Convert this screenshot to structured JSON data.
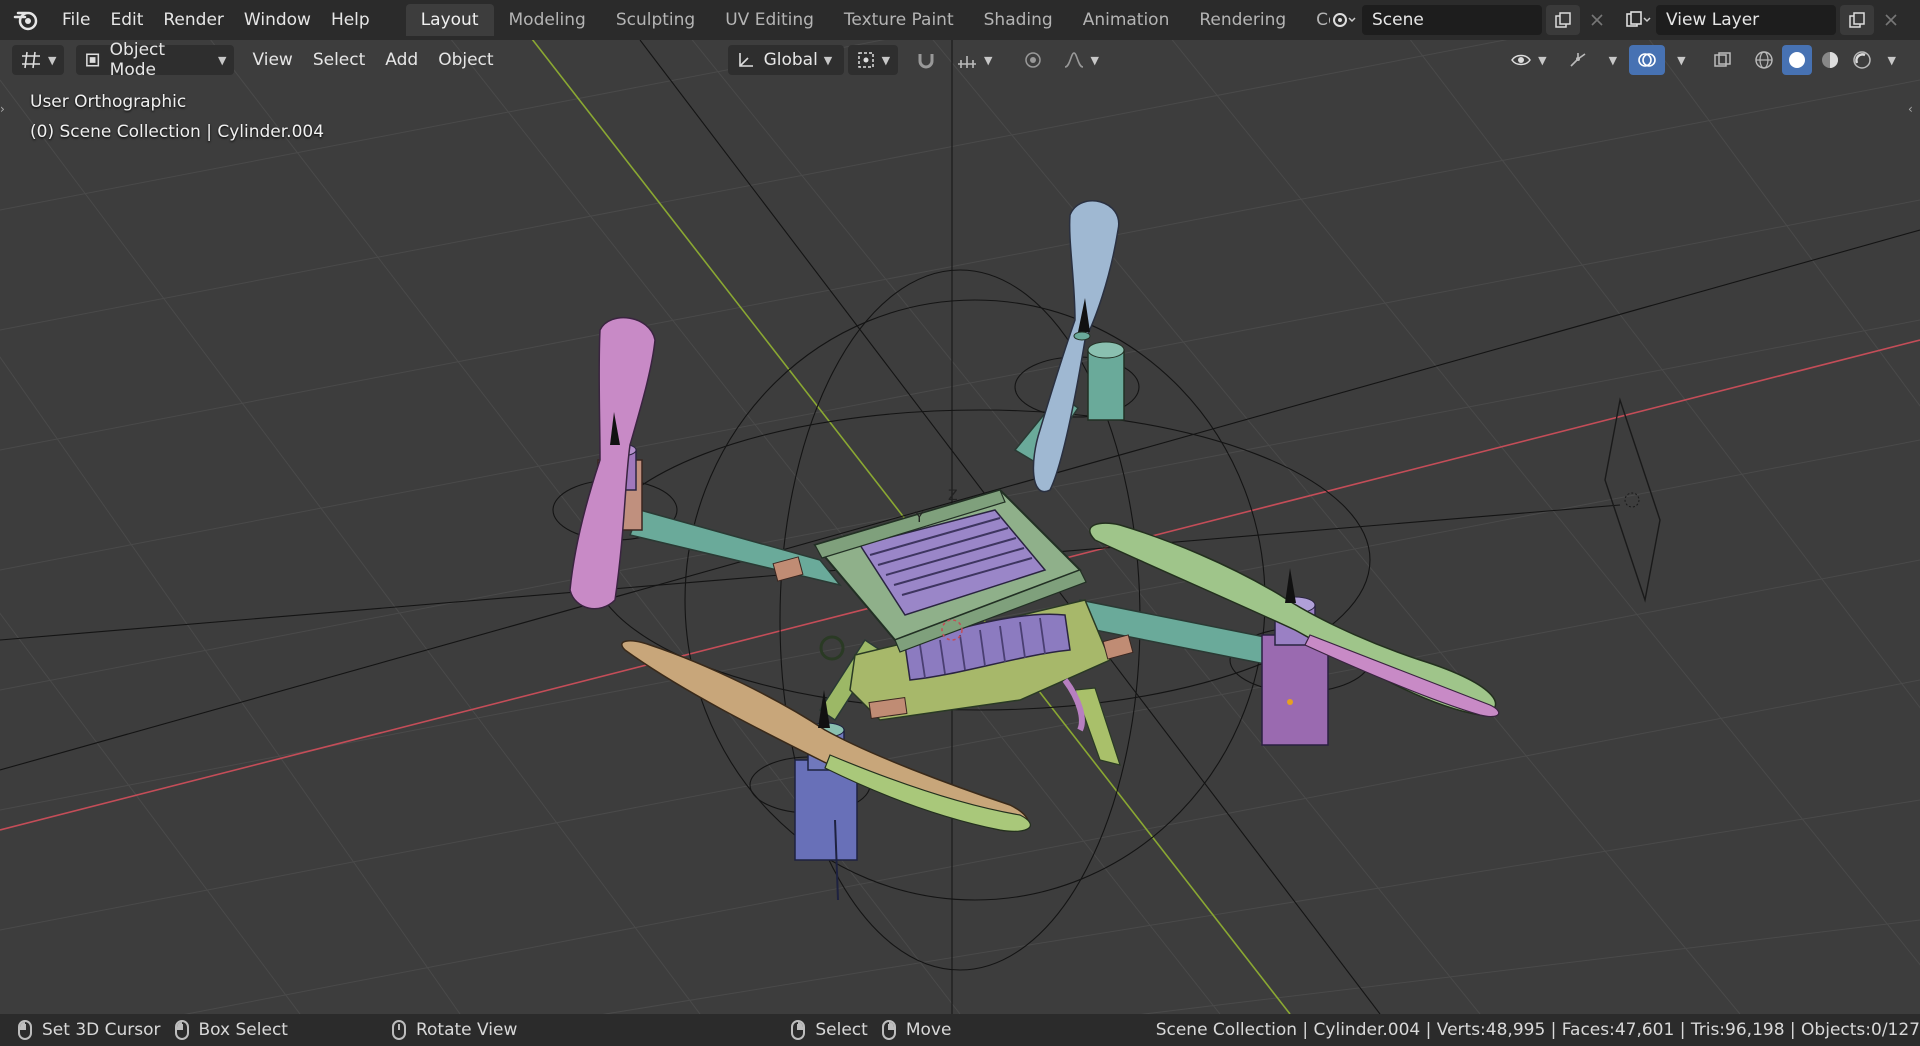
{
  "menu": [
    "File",
    "Edit",
    "Render",
    "Window",
    "Help"
  ],
  "workspace_tabs": [
    {
      "label": "Layout",
      "active": true
    },
    {
      "label": "Modeling",
      "active": false
    },
    {
      "label": "Sculpting",
      "active": false
    },
    {
      "label": "UV Editing",
      "active": false
    },
    {
      "label": "Texture Paint",
      "active": false
    },
    {
      "label": "Shading",
      "active": false
    },
    {
      "label": "Animation",
      "active": false
    },
    {
      "label": "Rendering",
      "active": false
    },
    {
      "label": "Compos",
      "active": false
    }
  ],
  "scene": {
    "name": "Scene",
    "view_layer": "View Layer"
  },
  "header": {
    "mode": "Object Mode",
    "view": "View",
    "select": "Select",
    "add": "Add",
    "object": "Object",
    "orientation": "Global"
  },
  "viewport": {
    "view_name": "User Orthographic",
    "collection_info": "(0) Scene Collection | Cylinder.004",
    "background": "#3d3d3d"
  },
  "statusbar": {
    "set_cursor": "Set 3D Cursor",
    "box_select": "Box Select",
    "rotate_view": "Rotate View",
    "select": "Select",
    "move": "Move",
    "stats": "Scene Collection | Cylinder.004 | Verts:48,995 | Faces:47,601 | Tris:96,198 | Objects:0/127"
  },
  "colors": {
    "accent": "#4772b3",
    "x_axis": "#c44d58",
    "y_axis": "#8aa832"
  }
}
